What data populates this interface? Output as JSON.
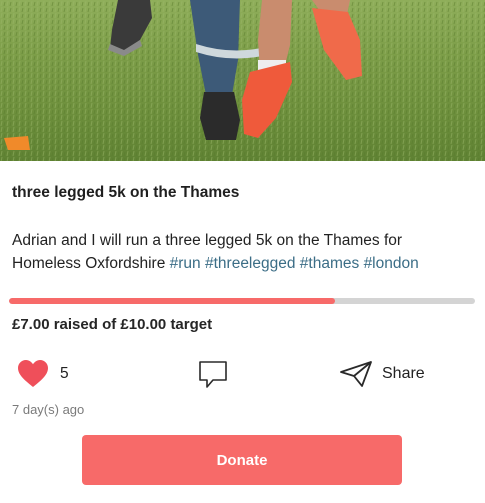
{
  "post": {
    "title": "three legged 5k on the Thames",
    "description_text": "Adrian and I will run a three legged 5k on the Thames for Homeless Oxfordshire",
    "hashtags": [
      "#run",
      "#threelegged",
      "#thames",
      "#london"
    ],
    "hero_image": "photo of runners' legs tied together on grass"
  },
  "fundraising": {
    "progress_fraction": 0.7,
    "raised_text": "£7.00 raised of £10.00 target"
  },
  "actions": {
    "like_icon": "heart-icon",
    "like_count": "5",
    "comment_icon": "comment-icon",
    "share_icon": "paper-plane-icon",
    "share_label": "Share"
  },
  "timestamp": "7 day(s) ago",
  "donate_label": "Donate",
  "colors": {
    "accent": "#f76a69",
    "heart": "#ef4f5a",
    "hashtag": "#3b6d86",
    "progress_track": "#d4d4d4"
  }
}
